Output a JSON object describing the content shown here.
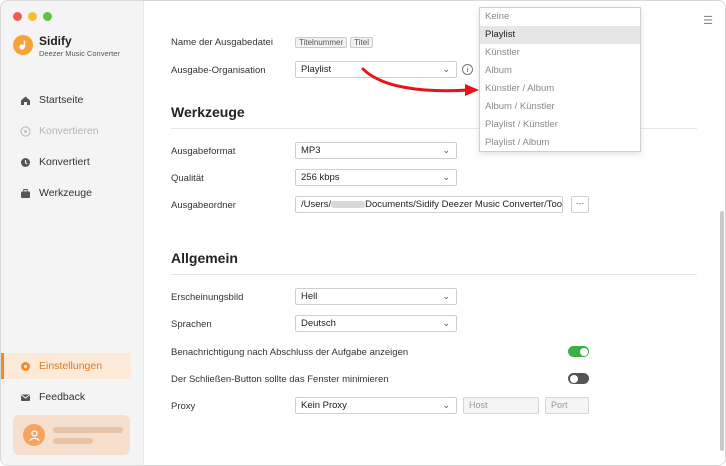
{
  "app": {
    "name": "Sidify",
    "subtitle": "Deezer Music Converter"
  },
  "sidebar": {
    "items": [
      {
        "label": "Startseite",
        "icon": "home-icon",
        "state": "normal"
      },
      {
        "label": "Konvertieren",
        "icon": "convert-icon",
        "state": "disabled"
      },
      {
        "label": "Konvertiert",
        "icon": "clock-icon",
        "state": "normal"
      },
      {
        "label": "Werkzeuge",
        "icon": "toolbox-icon",
        "state": "normal"
      },
      {
        "label": "Einstellungen",
        "icon": "settings-icon",
        "state": "active"
      },
      {
        "label": "Feedback",
        "icon": "mail-icon",
        "state": "normal"
      }
    ]
  },
  "settings": {
    "filename_label": "Name der Ausgabedatei",
    "filename_tags": [
      "Titelnummer",
      "Titel"
    ],
    "organization": {
      "label": "Ausgabe-Organisation",
      "value": "Playlist"
    },
    "tools_title": "Werkzeuge",
    "format": {
      "label": "Ausgabeformat",
      "value": "MP3"
    },
    "quality": {
      "label": "Qualität",
      "value": "256 kbps"
    },
    "folder": {
      "label": "Ausgabeordner",
      "prefix": "/Users/",
      "suffix": "Documents/Sidify Deezer Music Converter/Too",
      "browse": "···"
    },
    "general_title": "Allgemein",
    "appearance": {
      "label": "Erscheinungsbild",
      "value": "Hell"
    },
    "language": {
      "label": "Sprachen",
      "value": "Deutsch"
    },
    "notify": {
      "label": "Benachrichtigung nach Abschluss der Aufgabe anzeigen",
      "on": true
    },
    "close_min": {
      "label": "Der Schließen-Button sollte das Fenster minimieren",
      "on": false
    },
    "proxy": {
      "label": "Proxy",
      "value": "Kein Proxy",
      "host_placeholder": "Host",
      "port_placeholder": "Port"
    }
  },
  "dropdown": {
    "options": [
      "Keine",
      "Playlist",
      "Künstler",
      "Album",
      "Künstler / Album",
      "Album / Künstler",
      "Playlist / Künstler",
      "Playlist / Album"
    ],
    "selected": "Playlist"
  },
  "colors": {
    "accent": "#f08a2a",
    "toggle_on": "#3cb043",
    "arrow": "#e8141c"
  }
}
